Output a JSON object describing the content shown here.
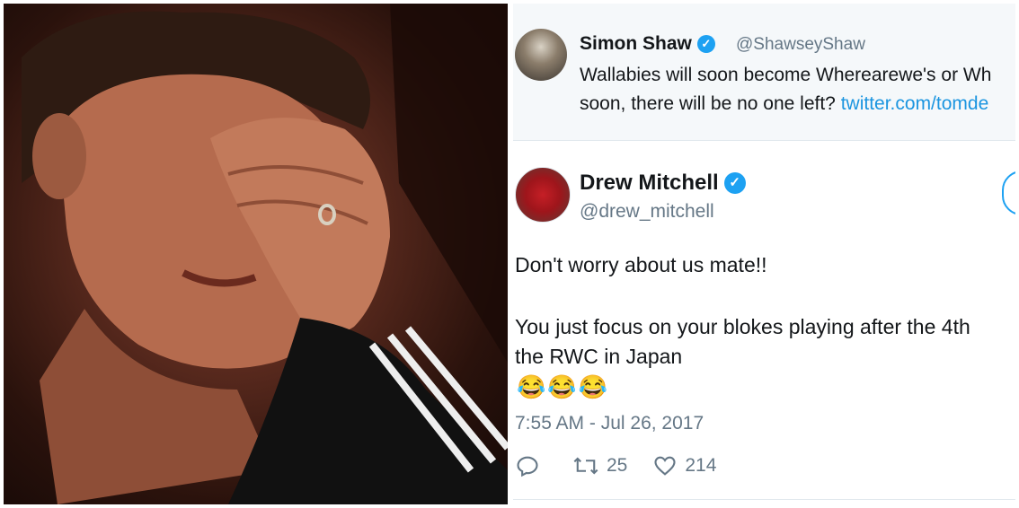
{
  "quoted_tweet": {
    "name": "Simon Shaw",
    "handle": "@ShawseyShaw",
    "text_line1": "Wallabies will soon become Wherearewe's or Wh",
    "text_line2_prefix": "soon, there will be no one left? ",
    "text_line2_link": "twitter.com/tomde"
  },
  "tweet": {
    "name": "Drew Mitchell",
    "handle": "@drew_mitchell",
    "line1": "Don't worry about us mate!!",
    "line2": "You just focus on your blokes playing after the 4th",
    "line3": "the RWC in Japan",
    "emoji": "😂😂😂",
    "timestamp": "7:55 AM - Jul 26, 2017",
    "retweets": "25",
    "likes": "214"
  },
  "icons": {
    "verified": "verified-badge-icon",
    "reply": "reply-icon",
    "retweet": "retweet-icon",
    "like": "heart-icon"
  },
  "colors": {
    "accent": "#1da1f2",
    "link": "#1b95e0",
    "muted": "#657786",
    "text": "#14171a"
  }
}
